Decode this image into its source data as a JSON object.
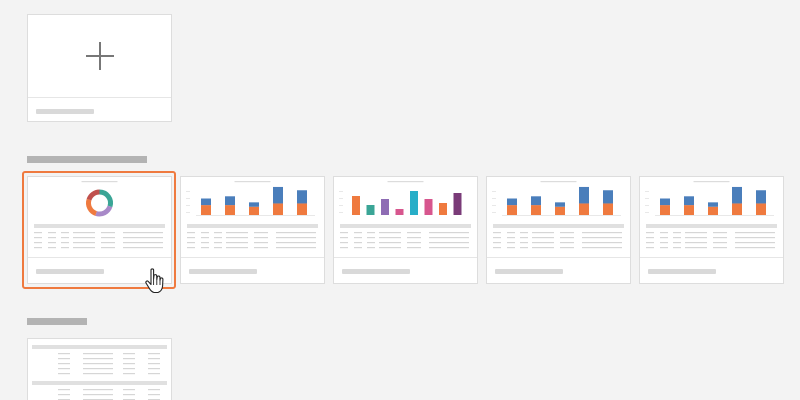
{
  "new_report": {
    "icon": "plus-icon"
  },
  "colors": {
    "accent": "#ef7a3f",
    "blue": "#4a7ebb",
    "orange": "#ef7a3f",
    "teal": "#3aa596",
    "purple": "#8e6cb4",
    "pink": "#d7568e",
    "cyan": "#27aec8",
    "plum": "#7a3b78",
    "dark_red": "#c0504d"
  },
  "templates": [
    {
      "kind": "donut",
      "segments": [
        {
          "value": 30,
          "color": "#3aa596"
        },
        {
          "value": 25,
          "color": "#a889c8"
        },
        {
          "value": 25,
          "color": "#ef7a3f"
        },
        {
          "value": 20,
          "color": "#c0504d"
        }
      ]
    },
    {
      "kind": "stacked-bar",
      "bars": [
        [
          6,
          6
        ],
        [
          6,
          8
        ],
        [
          5,
          4
        ],
        [
          7,
          15
        ],
        [
          7,
          12
        ]
      ]
    },
    {
      "kind": "multi-bar",
      "bars": [
        {
          "value": 19,
          "color": "#ef7a3f"
        },
        {
          "value": 10,
          "color": "#3aa596"
        },
        {
          "value": 16,
          "color": "#8e6cb4"
        },
        {
          "value": 6,
          "color": "#d7568e"
        },
        {
          "value": 24,
          "color": "#27aec8"
        },
        {
          "value": 16,
          "color": "#d7568e"
        },
        {
          "value": 12,
          "color": "#ef7a3f"
        },
        {
          "value": 22,
          "color": "#7a3b78"
        }
      ]
    },
    {
      "kind": "stacked-bar",
      "bars": [
        [
          6,
          6
        ],
        [
          6,
          8
        ],
        [
          5,
          4
        ],
        [
          7,
          15
        ],
        [
          7,
          12
        ]
      ]
    },
    {
      "kind": "stacked-bar",
      "bars": [
        [
          6,
          6
        ],
        [
          6,
          8
        ],
        [
          5,
          4
        ],
        [
          7,
          15
        ],
        [
          7,
          12
        ]
      ]
    }
  ],
  "cursor_icon": "hand-pointer-icon"
}
